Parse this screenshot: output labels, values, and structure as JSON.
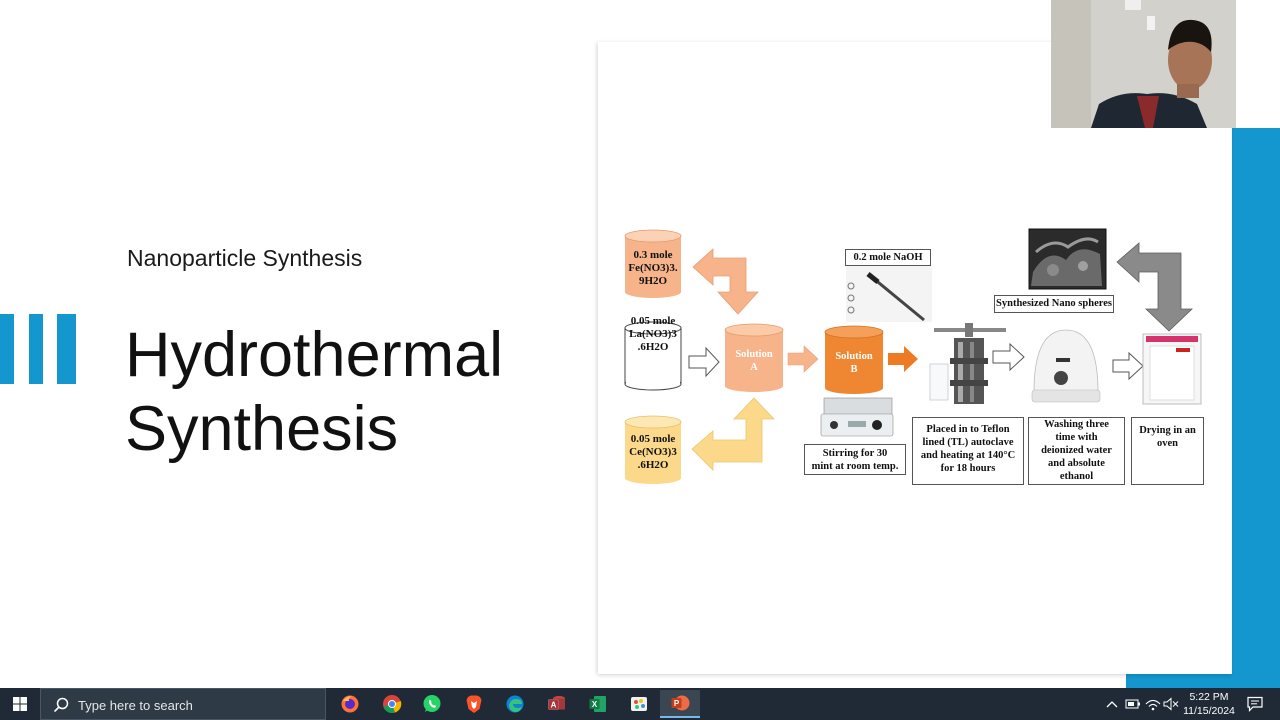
{
  "slide": {
    "subtitle": "Nanoparticle Synthesis",
    "title_line1": "Hydrothermal",
    "title_line2": "Synthesis",
    "accent_color": "#1496cf"
  },
  "figure": {
    "fe_line1": "0.3 mole",
    "fe_line2": "Fe(NO3)3.",
    "fe_line3": "9H2O",
    "la_line1": "0.05 mole",
    "la_line2": "La(NO3)3",
    "la_line3": ".6H2O",
    "ce_line1": "0.05 mole",
    "ce_line2": "Ce(NO3)3",
    "ce_line3": ".6H2O",
    "solution_a_line1": "Solution",
    "solution_a_line2": "A",
    "solution_b_line1": "Solution",
    "solution_b_line2": "B",
    "naoh": "0.2 mole NaOH",
    "nano_spheres": "Synthesized Nano spheres",
    "stirring_line1": "Stirring for 30",
    "stirring_line2": "mint at room temp.",
    "teflon_line1": "Placed in to Teflon",
    "teflon_line2": "lined (TL) autoclave",
    "teflon_line3": "and heating at 140°C",
    "teflon_line4": "for 18 hours",
    "wash_line1": "Washing three",
    "wash_line2": "time with",
    "wash_line3": "deionized water",
    "wash_line4": "and absolute",
    "wash_line5": "ethanol",
    "dry_line1": "Drying in an",
    "dry_line2": "oven"
  },
  "taskbar": {
    "search_placeholder": "Type here to search",
    "apps": [
      "firefox-icon",
      "chrome-icon",
      "whatsapp-icon",
      "brave-icon",
      "edge-icon",
      "access-icon",
      "excel-icon",
      "paint-icon",
      "powerpoint-icon"
    ],
    "time": "5:22 PM",
    "date": "11/15/2024"
  }
}
